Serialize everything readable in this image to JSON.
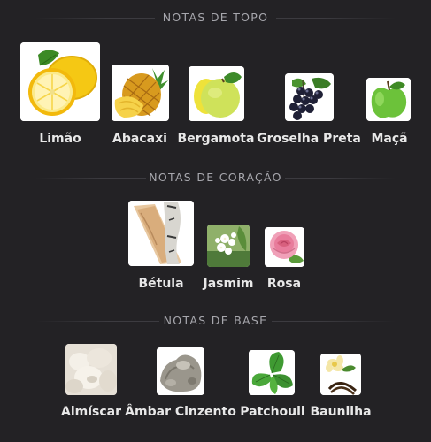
{
  "sections": [
    {
      "title": "NOTAS DE TOPO",
      "notes": [
        {
          "label": "Limão",
          "icon": "lemon-icon"
        },
        {
          "label": "Abacaxi",
          "icon": "pineapple-icon"
        },
        {
          "label": "Bergamota",
          "icon": "bergamot-icon"
        },
        {
          "label": "Groselha Preta",
          "icon": "blackcurrant-icon"
        },
        {
          "label": "Maçã",
          "icon": "apple-icon"
        }
      ]
    },
    {
      "title": "NOTAS DE CORAÇÃO",
      "notes": [
        {
          "label": "Bétula",
          "icon": "birch-icon"
        },
        {
          "label": "Jasmim",
          "icon": "jasmine-icon"
        },
        {
          "label": "Rosa",
          "icon": "rose-icon"
        }
      ]
    },
    {
      "title": "NOTAS DE BASE",
      "notes": [
        {
          "label": "Almíscar",
          "icon": "musk-icon"
        },
        {
          "label": "Âmbar Cinzento",
          "icon": "ambergris-icon"
        },
        {
          "label": "Patchouli",
          "icon": "patchouli-icon"
        },
        {
          "label": "Baunilha",
          "icon": "vanilla-icon"
        }
      ]
    }
  ]
}
